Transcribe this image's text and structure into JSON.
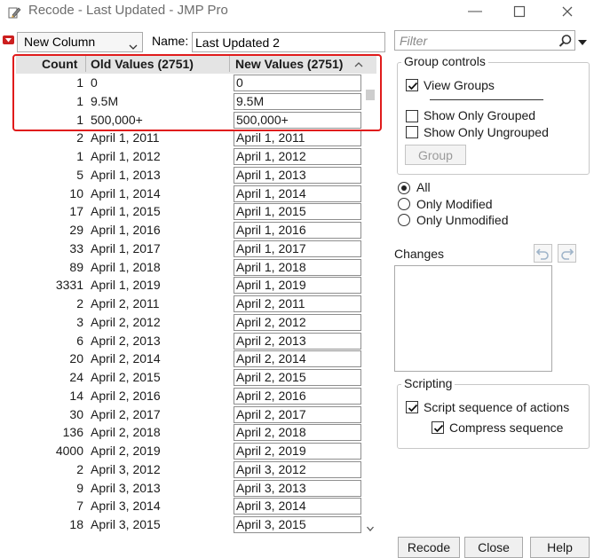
{
  "window": {
    "title": "Recode - Last Updated - JMP Pro"
  },
  "top": {
    "column_select": "New Column",
    "name_label": "Name:",
    "name_value": "Last Updated 2",
    "filter_placeholder": "Filter"
  },
  "table": {
    "headers": {
      "count": "Count",
      "old": "Old Values (2751)",
      "new": "New Values (2751)"
    },
    "rows": [
      {
        "count": "1",
        "old": "0",
        "new": "0"
      },
      {
        "count": "1",
        "old": "9.5M",
        "new": "9.5M"
      },
      {
        "count": "1",
        "old": "500,000+",
        "new": "500,000+"
      },
      {
        "count": "2",
        "old": "April 1, 2011",
        "new": "April 1, 2011"
      },
      {
        "count": "1",
        "old": "April 1, 2012",
        "new": "April 1, 2012"
      },
      {
        "count": "5",
        "old": "April 1, 2013",
        "new": "April 1, 2013"
      },
      {
        "count": "10",
        "old": "April 1, 2014",
        "new": "April 1, 2014"
      },
      {
        "count": "17",
        "old": "April 1, 2015",
        "new": "April 1, 2015"
      },
      {
        "count": "29",
        "old": "April 1, 2016",
        "new": "April 1, 2016"
      },
      {
        "count": "33",
        "old": "April 1, 2017",
        "new": "April 1, 2017"
      },
      {
        "count": "89",
        "old": "April 1, 2018",
        "new": "April 1, 2018"
      },
      {
        "count": "3331",
        "old": "April 1, 2019",
        "new": "April 1, 2019"
      },
      {
        "count": "2",
        "old": "April 2, 2011",
        "new": "April 2, 2011"
      },
      {
        "count": "3",
        "old": "April 2, 2012",
        "new": "April 2, 2012"
      },
      {
        "count": "6",
        "old": "April 2, 2013",
        "new": "April 2, 2013"
      },
      {
        "count": "20",
        "old": "April 2, 2014",
        "new": "April 2, 2014"
      },
      {
        "count": "24",
        "old": "April 2, 2015",
        "new": "April 2, 2015"
      },
      {
        "count": "14",
        "old": "April 2, 2016",
        "new": "April 2, 2016"
      },
      {
        "count": "30",
        "old": "April 2, 2017",
        "new": "April 2, 2017"
      },
      {
        "count": "136",
        "old": "April 2, 2018",
        "new": "April 2, 2018"
      },
      {
        "count": "4000",
        "old": "April 2, 2019",
        "new": "April 2, 2019"
      },
      {
        "count": "2",
        "old": "April 3, 2012",
        "new": "April 3, 2012"
      },
      {
        "count": "9",
        "old": "April 3, 2013",
        "new": "April 3, 2013"
      },
      {
        "count": "7",
        "old": "April 3, 2014",
        "new": "April 3, 2014"
      },
      {
        "count": "18",
        "old": "April 3, 2015",
        "new": "April 3, 2015"
      }
    ]
  },
  "group_controls": {
    "title": "Group controls",
    "view_groups": "View Groups",
    "view_groups_checked": true,
    "show_only_grouped": "Show Only Grouped",
    "show_only_grouped_checked": false,
    "show_only_ungrouped": "Show Only Ungrouped",
    "show_only_ungrouped_checked": false,
    "group_button": "Group"
  },
  "filter_options": {
    "all": "All",
    "only_modified": "Only Modified",
    "only_unmodified": "Only Unmodified",
    "selected": "All"
  },
  "changes": {
    "label": "Changes"
  },
  "scripting": {
    "title": "Scripting",
    "script_sequence": "Script sequence of actions",
    "script_sequence_checked": true,
    "compress_sequence": "Compress sequence",
    "compress_sequence_checked": true
  },
  "buttons": {
    "recode": "Recode",
    "close": "Close",
    "help": "Help"
  },
  "colors": {
    "highlight": "#e01b1b",
    "header_bg": "#e4e4e4",
    "menu_red": "#cc1f1f"
  }
}
